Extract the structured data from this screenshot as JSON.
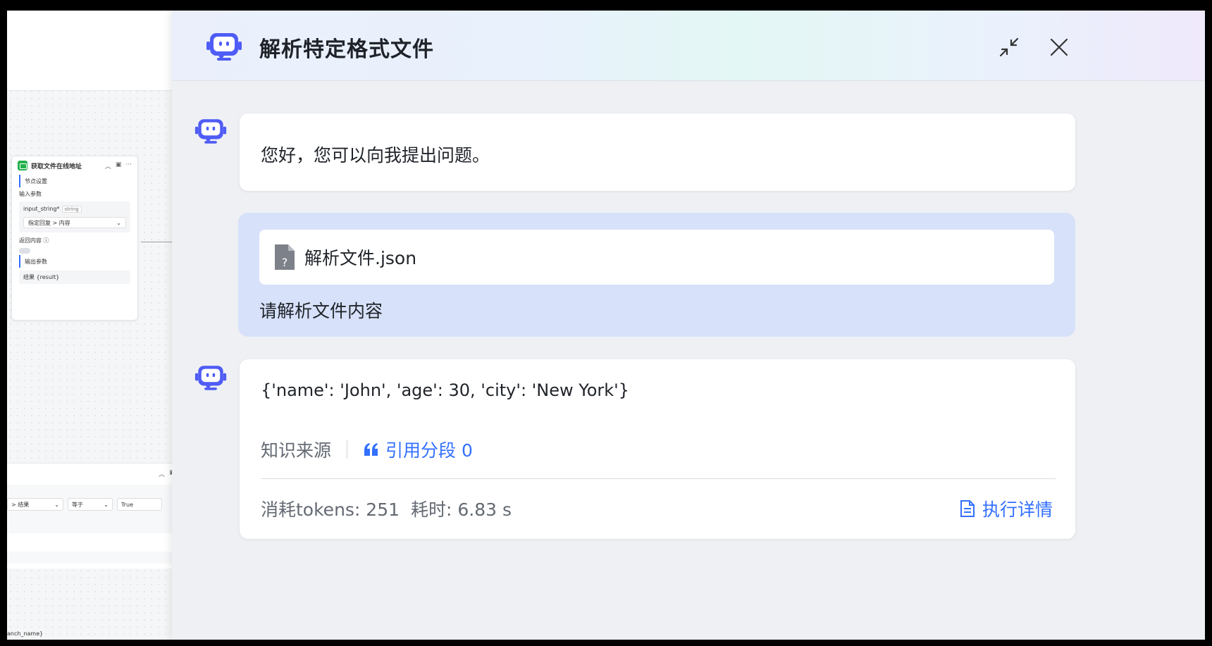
{
  "colors": {
    "accent": "#3370ff",
    "robot": "#4f5cf5",
    "user_bubble": "#d7e1fa"
  },
  "canvas": {
    "node": {
      "title": "获取文件在线地址",
      "section_settings": "节点设置",
      "input_params": "输入参数",
      "param_name": "input_string*",
      "param_type": "string",
      "param_value": "指定回复 > 内容",
      "return_content": "返回内容",
      "output_params": "输出参数",
      "output_value": "结果 {result}"
    },
    "condition": {
      "field": "> 结果",
      "operator": "等于",
      "value": "True"
    },
    "footer_text": "anch_name}"
  },
  "chat": {
    "title": "解析特定格式文件",
    "icons": {
      "minimize": "minimize-icon",
      "close": "close-icon",
      "avatar": "robot-icon",
      "file": "file-unknown-icon",
      "quote": "quote-icon",
      "doc": "document-icon"
    },
    "greeting": "您好，您可以向我提出问题。",
    "user_message": {
      "file_name": "解析文件.json",
      "text": "请解析文件内容"
    },
    "answer": {
      "text": "{'name': 'John', 'age': 30, 'city': 'New York'}",
      "source_label": "知识来源",
      "citation": "引用分段 0",
      "tokens": "消耗tokens: 251",
      "time": "耗时: 6.83 s",
      "detail": "执行详情"
    }
  }
}
